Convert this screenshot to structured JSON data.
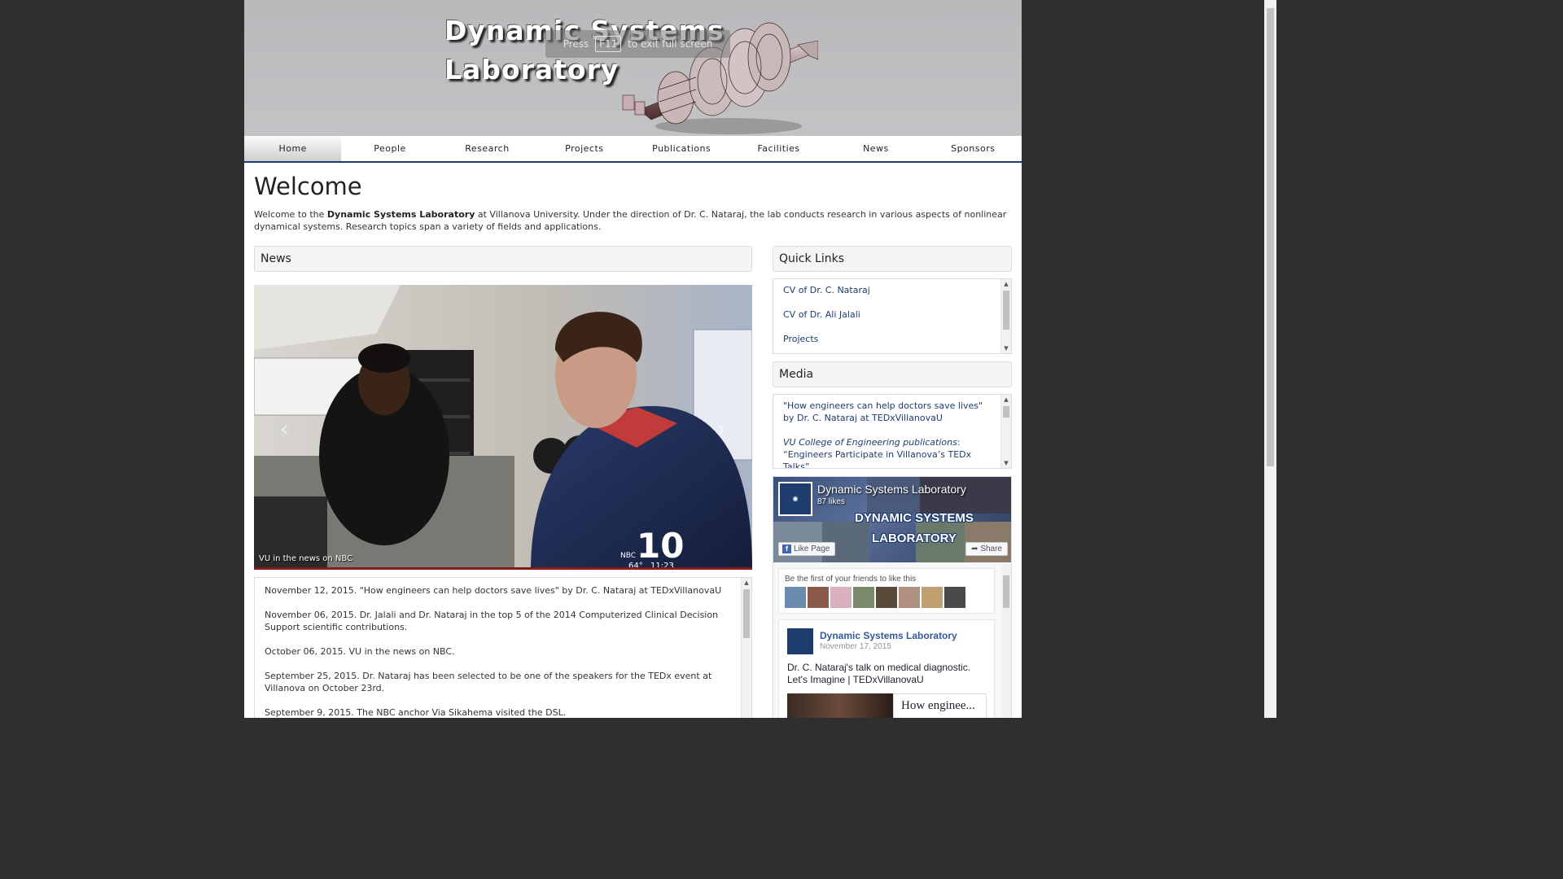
{
  "header": {
    "title_line1": "Dynamic Systems",
    "title_line2": "Laboratory",
    "fullscreen_notice": {
      "before": "Press",
      "key": "F11",
      "after": "to exit full screen"
    }
  },
  "nav": {
    "items": [
      {
        "label": "Home",
        "active": true
      },
      {
        "label": "People"
      },
      {
        "label": "Research"
      },
      {
        "label": "Projects"
      },
      {
        "label": "Publications"
      },
      {
        "label": "Facilities"
      },
      {
        "label": "News"
      },
      {
        "label": "Sponsors"
      }
    ]
  },
  "welcome": {
    "title": "Welcome",
    "text_before": "Welcome to the ",
    "lab_name": "Dynamic Systems Laboratory",
    "text_after": " at Villanova University. Under the direction of Dr. C. Nataraj, the lab conducts research in various aspects of nonlinear dynamical systems. Research topics span a variety of fields and applications."
  },
  "news": {
    "heading": "News",
    "carousel": {
      "caption": "VU in the news on NBC",
      "prev_glyph": "‹",
      "next_glyph": "›",
      "tv_channel": "10",
      "tv_network": "NBC",
      "tv_temp": "64°",
      "tv_time": "11:23"
    },
    "items": [
      "November 12, 2015. \"How engineers can help doctors save lives\" by Dr. C. Nataraj at TEDxVillanovaU",
      "November 06, 2015. Dr. Jalali and Dr. Nataraj in the top 5 of the 2014 Computerized Clinical Decision Support scientific contributions.",
      "October 06, 2015. VU in the news on NBC.",
      "September 25, 2015. Dr. Nataraj has been selected to be one of the speakers for the TEDx event at Villanova on October 23rd.",
      "September 9, 2015. The NBC anchor Via Sikahema visited the DSL."
    ]
  },
  "quick_links": {
    "heading": "Quick Links",
    "items": [
      "CV of Dr. C. Nataraj",
      "CV of Dr. Ali Jalali",
      "Projects"
    ]
  },
  "media": {
    "heading": "Media",
    "item1": "\"How engineers can help doctors save lives\" by Dr. C. Nataraj at TEDxVillanovaU",
    "item2_italic": "VU College of Engineering publications",
    "item2_rest": ": “Engineers Participate in Villanova’s TEDx Talks”"
  },
  "facebook": {
    "page_name": "Dynamic Systems Laboratory",
    "likes": "87 likes",
    "cover_line1": "DYNAMIC SYSTEMS",
    "cover_line2": "LABORATORY",
    "like_button": "Like Page",
    "share_button": "Share",
    "friends_text": "Be the first of your friends to like this",
    "post": {
      "author": "Dynamic Systems Laboratory",
      "date": "November 17, 2015",
      "text": "Dr. C. Nataraj's talk on medical diagnostic. Let's Imagine | TEDxVillanovaU",
      "link_title": "How enginee..."
    }
  },
  "colors": {
    "nav_border": "#1f3c6e",
    "link": "#1f3c6e",
    "fb_blue": "#365899"
  }
}
